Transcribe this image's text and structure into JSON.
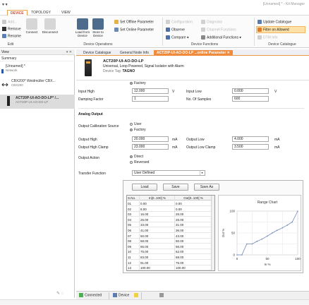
{
  "window": {
    "title": "[Unnamed] * - Kit Manager"
  },
  "menu": {
    "tabs": [
      "DEVICE",
      "TOPOLOGY",
      "VIEW"
    ],
    "active": "DEVICE"
  },
  "ribbon": {
    "small_left": [
      "Add...",
      "Remove",
      "Rename"
    ],
    "connect_disconnect": [
      "Connect",
      "Disconnect"
    ],
    "load_from_device": "Load from Device",
    "store_to_device": "Store to Device",
    "set_offline_parameter": "Set Offline Parameter",
    "set_online_parameter": "Set Online Parameter",
    "configuration": "Configuration",
    "observe": "Observe",
    "compare": "Compare",
    "diagnosis": "Diagnosis",
    "channel_functions": "Channel Functions",
    "additional_functions": "Additional Functions",
    "update_catalogue": "Update Catalogue",
    "filter_on_allowed": "Filter on Allowed",
    "dtm_info": "DTM Info",
    "groups": [
      "Edit",
      "Device Operations",
      "Device Functions",
      "Device Catalogue"
    ]
  },
  "left_panel": {
    "header": "View",
    "summary": "Summary",
    "tree": [
      {
        "label": "[Unnamed] *",
        "sub": "Network"
      },
      {
        "label": "CBX200* Weidmüller CBX...",
        "sub": "CBX200"
      },
      {
        "label": "ACT20P-UI-AO-DO-LP* /...",
        "sub": "ACT20P-UI-AO-DO-LP"
      }
    ]
  },
  "doc_tabs": [
    "Device Catalogue",
    "General Node Info",
    "ACT20P-UI-AO-DO-LP ...online Parameter"
  ],
  "device": {
    "name": "ACT20P-UI-AO-DO-LP",
    "description": "Universal, Loop Powered, Signal Isolator with Alarm",
    "tag_label": "Device Tag:",
    "tag_value": "TAGNO"
  },
  "form": {
    "factory_top": "Factory",
    "input_high_label": "Input High",
    "input_high_value": "12.000",
    "input_high_unit": "V",
    "input_low_label": "Input Low",
    "input_low_value": "0.000",
    "input_low_unit": "V",
    "damping_label": "Damping Factor",
    "damping_value": "1",
    "samples_label": "No. Of Samples",
    "samples_value": "600",
    "analog_output_heading": "Analog Output",
    "calibration_label": "Output Calibration Source",
    "calibration_options": [
      "User",
      "Factory"
    ],
    "calibration_selected": "Factory",
    "output_high_label": "Output High",
    "output_high_value": "20.000",
    "output_high_unit": "mA",
    "output_low_label": "Output Low",
    "output_low_value": "4.000",
    "output_low_unit": "mA",
    "output_high_clamp_label": "Output High Clamp",
    "output_high_clamp_value": "23.000",
    "output_high_clamp_unit": "mA",
    "output_low_clamp_label": "Output Low Clamp",
    "output_low_clamp_value": "3.500",
    "output_low_clamp_unit": "mA",
    "output_action_label": "Output Action",
    "output_action_options": [
      "Direct",
      "Reversed"
    ],
    "output_action_selected": "Direct",
    "transfer_label": "Transfer Function",
    "transfer_value": "User Defined"
  },
  "transfer_panel": {
    "buttons": [
      "Load",
      "Save",
      "Save As"
    ],
    "columns": [
      "S.No.",
      "In[0..100] %",
      "Out[0..100] %"
    ],
    "rows": [
      [
        "01",
        "0.00",
        "0.00"
      ],
      [
        "02",
        "8.00",
        "0.00"
      ],
      [
        "03",
        "16.00",
        "25.00"
      ],
      [
        "04",
        "25.00",
        "25.00"
      ],
      [
        "05",
        "33.00",
        "31.00"
      ],
      [
        "06",
        "41.00",
        "36.00"
      ],
      [
        "07",
        "50.00",
        "43.00"
      ],
      [
        "08",
        "58.00",
        "50.00"
      ],
      [
        "09",
        "66.00",
        "56.00"
      ],
      [
        "10",
        "75.00",
        "62.00"
      ],
      [
        "11",
        "83.00",
        "68.00"
      ],
      [
        "12",
        "91.00",
        "75.00"
      ],
      [
        "13",
        "100.00",
        "100.00"
      ]
    ]
  },
  "chart_data": {
    "type": "line",
    "title": "Range Chart",
    "xlabel": "In %",
    "ylabel": "Out %",
    "xlim": [
      0,
      100
    ],
    "ylim": [
      0,
      100
    ],
    "xticks": [
      "0",
      "50",
      "100"
    ],
    "yticks": [
      "0",
      "50",
      "100"
    ],
    "grid": true,
    "series": [
      {
        "x": [
          0,
          8,
          16,
          25,
          33,
          41,
          50,
          58,
          66,
          75,
          83,
          91,
          100
        ],
        "y": [
          0,
          0,
          25,
          25,
          31,
          36,
          43,
          50,
          56,
          62,
          68,
          75,
          100
        ]
      }
    ],
    "line_color": "#6f86b8"
  },
  "status": {
    "connected": "Connected",
    "device": "Device"
  }
}
